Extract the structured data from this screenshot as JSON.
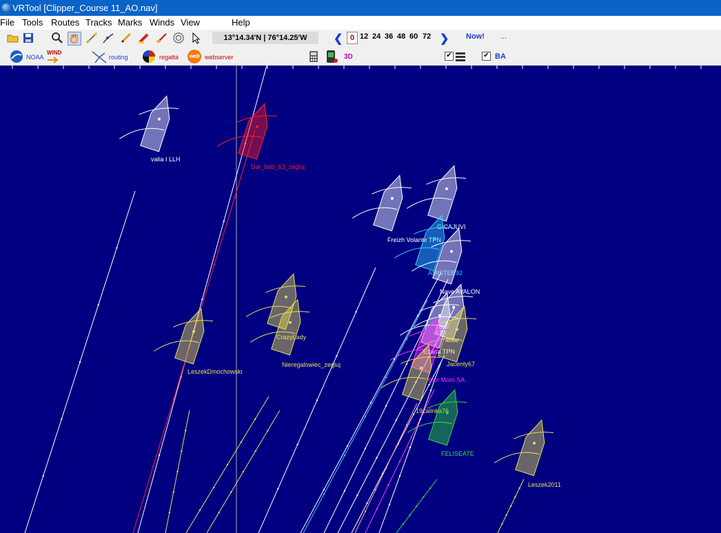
{
  "window": {
    "title": "VRTool [Clipper_Course 11_AO.nav]"
  },
  "menu": [
    "File",
    "Tools",
    "Routes",
    "Tracks",
    "Marks",
    "Winds",
    "View",
    "Help"
  ],
  "toolbar": {
    "coordinates": "13°14.34'N | 76°14.25'W",
    "hours": [
      "0",
      "12",
      "24",
      "36",
      "48",
      "60",
      "72"
    ],
    "now_label": "Now!",
    "more_label": "...",
    "noaa_label": "NOAA",
    "wind_label": "WIND",
    "routing_label": "routing",
    "regatta_label": "regatta",
    "webserver_label": "webserver",
    "web_label": "web",
    "threed_label": "3D",
    "check_mark": "✔",
    "ba_label": "BA"
  },
  "boats": [
    {
      "name": "valia I LLH",
      "color": "#ffffff"
    },
    {
      "name": "Dar_bob_63_zegluj",
      "color": "#ff2020"
    },
    {
      "name": "GICAJUVI",
      "color": "#ffffff"
    },
    {
      "name": "Freizh Volante TPN",
      "color": "#ffffff"
    },
    {
      "name": "AMISTER92",
      "color": "#33ccff"
    },
    {
      "name": "Nave AVALON",
      "color": "#ffffff"
    },
    {
      "name": "CrazyLady",
      "color": "#e8e050"
    },
    {
      "name": "Nieregalowiec_zegluj",
      "color": "#e8e050"
    },
    {
      "name": "LeszekDmochowski",
      "color": "#e8e050"
    },
    {
      "name": "aidar",
      "color": "#ffffff"
    },
    {
      "name": "Ezana TPN",
      "color": "#ffffff"
    },
    {
      "name": "Jacenty67",
      "color": "#e8e050"
    },
    {
      "name": "Your Mom SA",
      "color": "#ff33ff"
    },
    {
      "name": "19calinka76",
      "color": "#e8e050"
    },
    {
      "name": "FELISEATE",
      "color": "#33dd33"
    },
    {
      "name": "Leszek2011",
      "color": "#e8e050"
    }
  ]
}
